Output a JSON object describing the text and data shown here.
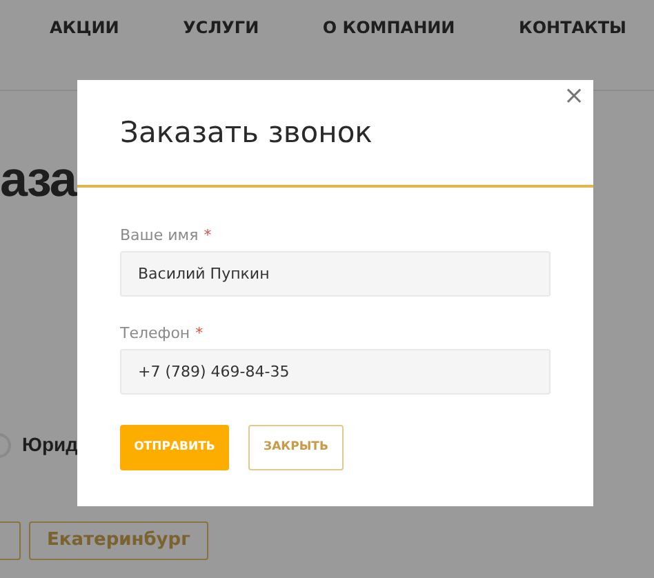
{
  "nav": [
    "АКЦИИ",
    "УСЛУГИ",
    "О КОМПАНИИ",
    "КОНТАКТЫ"
  ],
  "page_heading": "аза",
  "radio": {
    "label": "Юрид",
    "selected": false
  },
  "city_buttons": [
    {
      "kind": "cut"
    },
    {
      "kind": "labeled",
      "label": "Екатеринбург"
    }
  ],
  "modal": {
    "title": "Заказать звонок",
    "close": "×",
    "required_mark": "*",
    "fields": [
      {
        "label": "Ваше имя",
        "required": true,
        "value": "Василий Пупкин"
      },
      {
        "label": "Телефон",
        "required": true,
        "value": "+7 (789) 469-84-35"
      }
    ],
    "submit": "ОТПРАВИТЬ",
    "dismiss": "ЗАКРЫТЬ"
  }
}
